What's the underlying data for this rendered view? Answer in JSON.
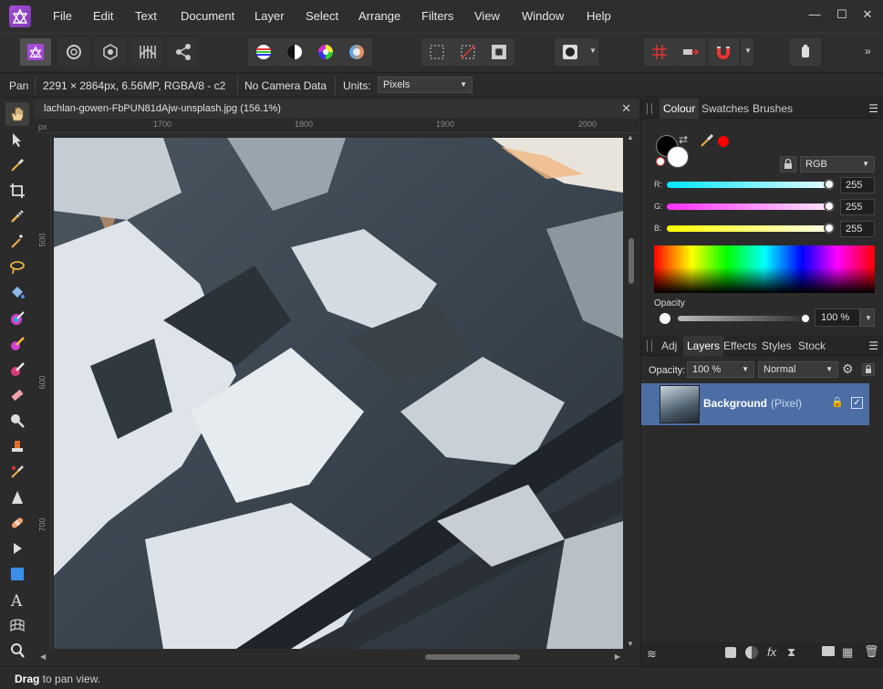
{
  "menu": [
    "File",
    "Edit",
    "Text",
    "Document",
    "Layer",
    "Select",
    "Arrange",
    "Filters",
    "View",
    "Window",
    "Help"
  ],
  "context": {
    "tool": "Pan",
    "doc_info": "2291 × 2864px, 6.56MP, RGBA/8 - c2",
    "camera": "No Camera Data",
    "units_label": "Units:",
    "units_value": "Pixels"
  },
  "document": {
    "tab_title": "lachlan-gowen-FbPUN81dAjw-unsplash.jpg (156.1%)",
    "ruler_unit": "px",
    "ruler_top": [
      "1700",
      "1800",
      "1900",
      "2000"
    ],
    "ruler_left": [
      "500",
      "600",
      "700"
    ]
  },
  "colour_panel": {
    "tabs": [
      "Colour",
      "Swatches",
      "Brushes"
    ],
    "active_tab": "Colour",
    "model": "RGB",
    "channels": [
      {
        "label": "R:",
        "value": "255",
        "color": "#00e5ff"
      },
      {
        "label": "G:",
        "value": "255",
        "color": "#ff2fff"
      },
      {
        "label": "B:",
        "value": "255",
        "color": "#ffff00"
      }
    ],
    "opacity_label": "Opacity",
    "opacity_value": "100 %"
  },
  "layers_panel": {
    "tabs": [
      "Adj",
      "Layers",
      "Effects",
      "Styles",
      "Stock"
    ],
    "active_tab": "Layers",
    "opacity_label": "Opacity:",
    "opacity_value": "100 %",
    "blend_mode": "Normal",
    "layers": [
      {
        "name": "Background",
        "kind": "(Pixel)"
      }
    ]
  },
  "status": {
    "bold": "Drag",
    "text": " to pan view."
  }
}
